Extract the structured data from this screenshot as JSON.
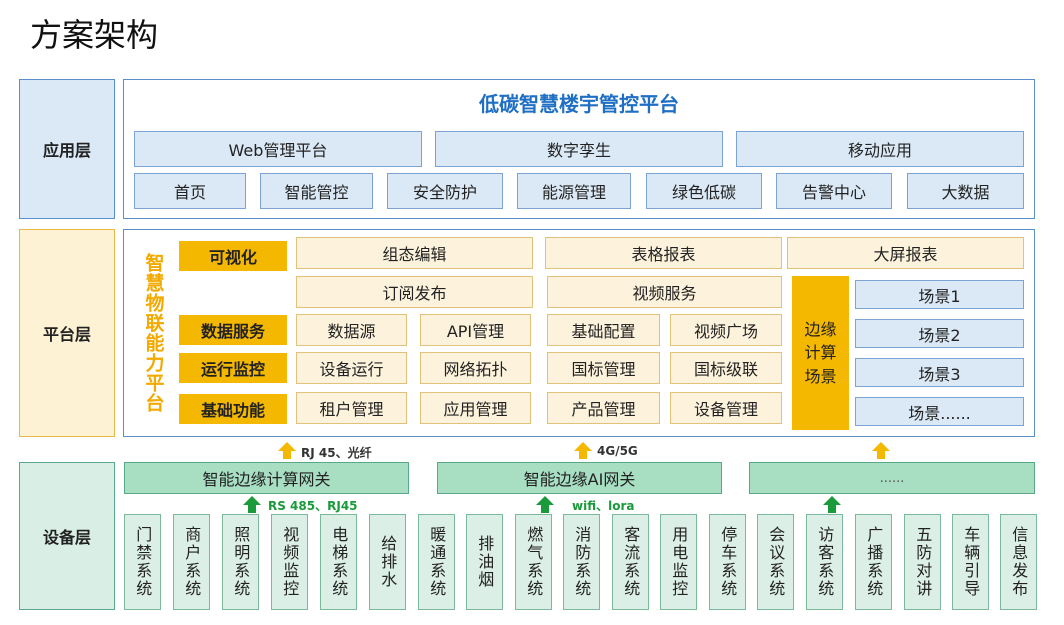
{
  "title": "方案架构",
  "layers": {
    "app": "应用层",
    "platform": "平台层",
    "device": "设备层"
  },
  "app": {
    "heading": "低碳智慧楼宇管控平台",
    "row1": [
      "Web管理平台",
      "数字孪生",
      "移动应用"
    ],
    "row2": [
      "首页",
      "智能管控",
      "安全防护",
      "能源管理",
      "绿色低碳",
      "告警中心",
      "大数据"
    ]
  },
  "platform": {
    "vertical_title": "智慧物联能力平台",
    "categories": [
      "可视化",
      "数据服务",
      "运行监控",
      "基础功能"
    ],
    "visual": [
      "组态编辑",
      "表格报表",
      "大屏报表"
    ],
    "row2": [
      "订阅发布",
      "视频服务"
    ],
    "data_service": [
      "数据源",
      "API管理",
      "基础配置",
      "视频广场"
    ],
    "monitor": [
      "设备运行",
      "网络拓扑",
      "国标管理",
      "国标级联"
    ],
    "basic": [
      "租户管理",
      "应用管理",
      "产品管理",
      "设备管理"
    ],
    "edge_label": "边缘计算场景",
    "scenes": [
      "场景1",
      "场景2",
      "场景3",
      "场景......"
    ]
  },
  "connectors": {
    "top": [
      "RJ 45、光纤",
      "4G/5G"
    ],
    "bottom": [
      "RS 485、RJ45",
      "wifi、lora"
    ]
  },
  "gateways": [
    "智能边缘计算网关",
    "智能边缘AI网关",
    "......"
  ],
  "devices": [
    "门禁系统",
    "商户系统",
    "照明系统",
    "视频监控",
    "电梯系统",
    "给排水",
    "暖通系统",
    "排油烟",
    "燃气系统",
    "消防系统",
    "客流系统",
    "用电监控",
    "停车系统",
    "会议系统",
    "访客系统",
    "广播系统",
    "五防对讲",
    "车辆引导",
    "信息发布"
  ],
  "colors": {
    "blue_fill": "#dbe9f6",
    "blue_border": "#5b8fc9",
    "gold": "#f5b800",
    "heading_blue": "#1f6fc4",
    "green_fill": "#a8dfc3",
    "arrow_green": "#1a9a3a"
  }
}
